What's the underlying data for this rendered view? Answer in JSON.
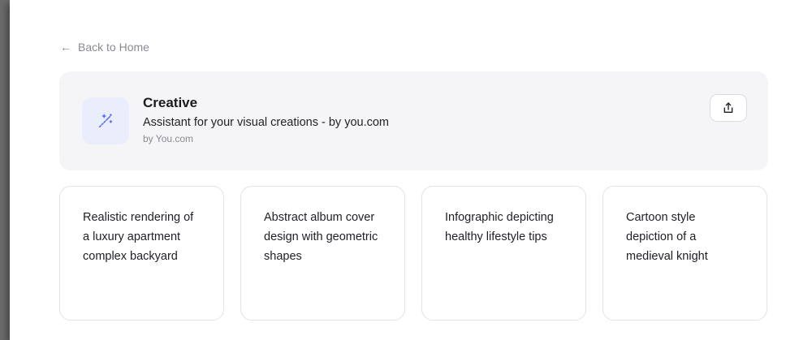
{
  "nav": {
    "back_label": "Back to Home"
  },
  "assistant": {
    "name": "Creative",
    "description": "Assistant for your visual creations - by you.com",
    "byline": "by You.com",
    "icon": "magic-wand-icon",
    "accent": "#5b6cf0"
  },
  "actions": {
    "share_icon": "share-icon"
  },
  "suggestions": [
    {
      "text": "Realistic rendering of a luxury apartment complex backyard"
    },
    {
      "text": "Abstract album cover design with geometric shapes"
    },
    {
      "text": "Infographic depicting healthy lifestyle tips"
    },
    {
      "text": "Cartoon style depiction of a medieval knight"
    }
  ]
}
